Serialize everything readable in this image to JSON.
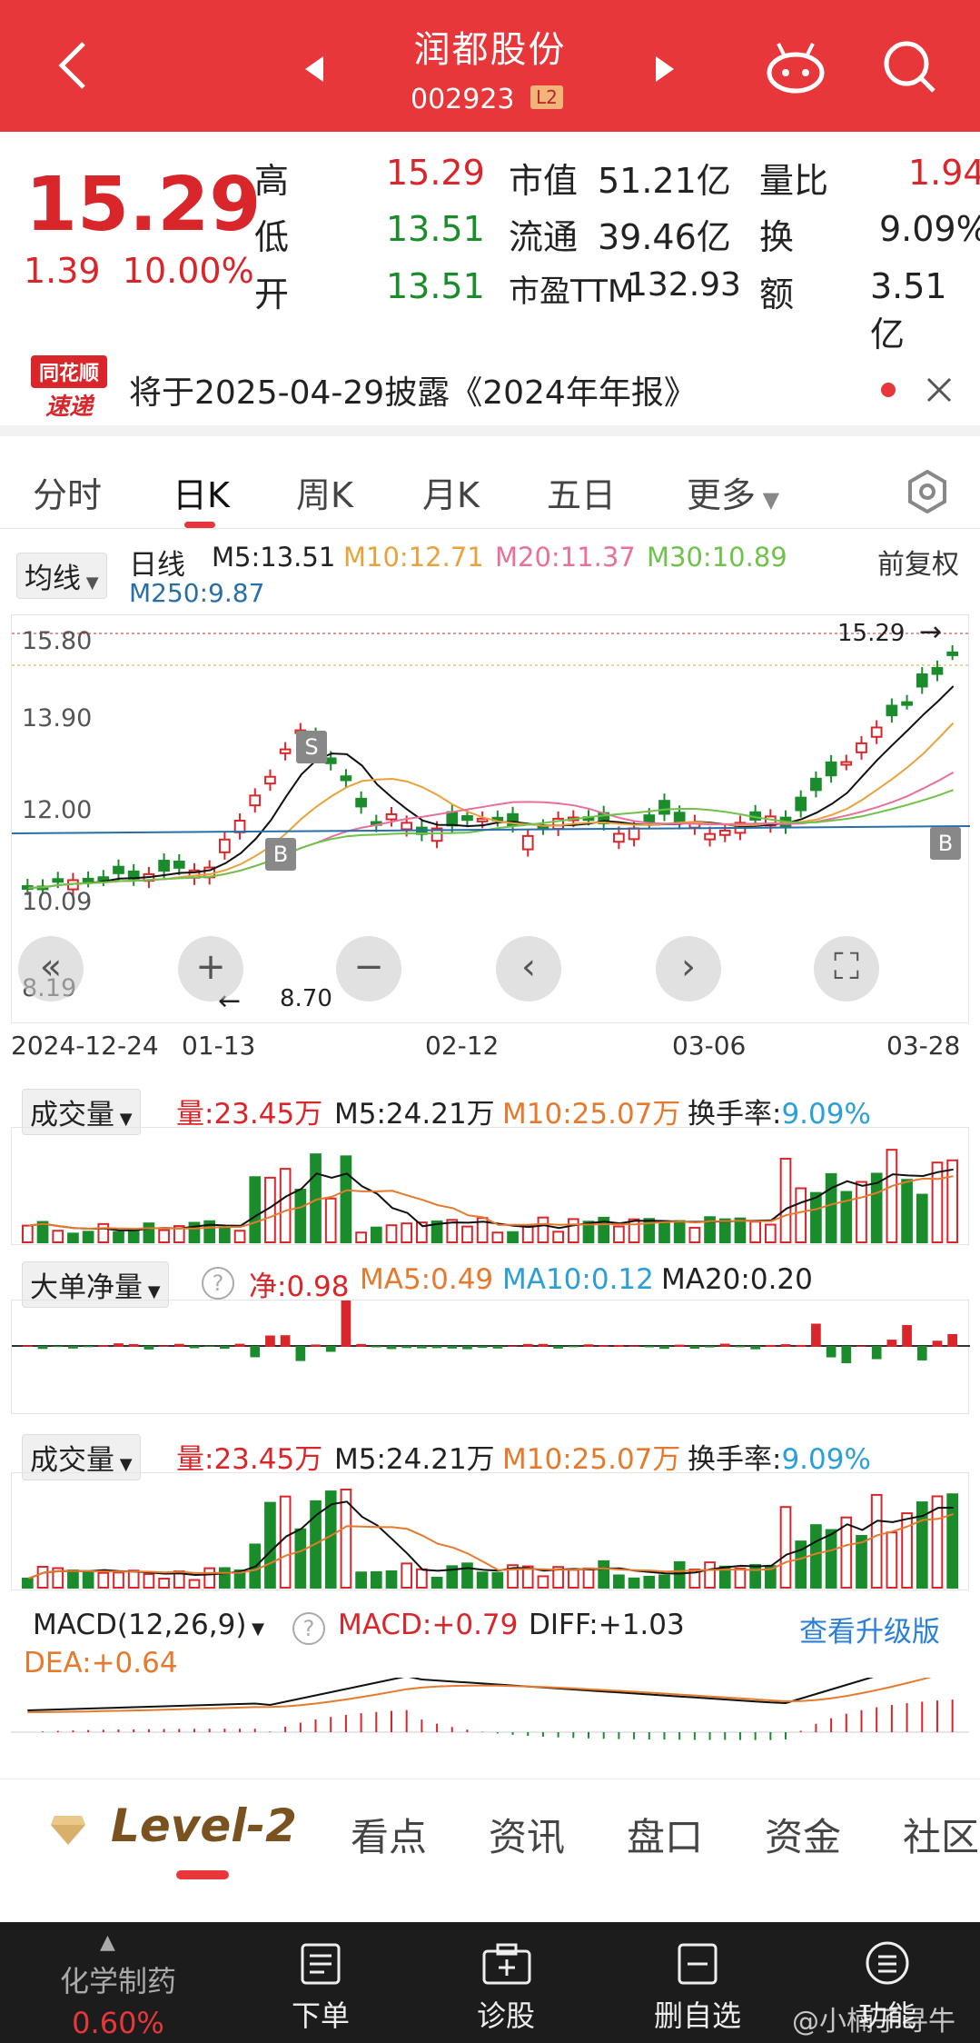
{
  "header": {
    "title": "润都股份",
    "code": "002923",
    "level_badge": "L2"
  },
  "quote": {
    "price": "15.29",
    "change": "1.39",
    "change_pct": "10.00%",
    "high_label": "高",
    "high": "15.29",
    "low_label": "低",
    "low": "13.51",
    "open_label": "开",
    "open": "13.51",
    "mktcap_label": "市值",
    "mktcap": "51.21亿",
    "float_label": "流通",
    "float": "39.46亿",
    "pe_label": "市盈TTM",
    "pe": "132.93",
    "volratio_label": "量比",
    "volratio": "1.94",
    "turnover_label": "换",
    "turnover": "9.09%",
    "amount_label": "额",
    "amount": "3.51亿"
  },
  "news": {
    "brand_line1": "同花顺",
    "brand_line2": "速递",
    "text": "将于2025-04-29披露《2024年年报》"
  },
  "tabs": [
    "分时",
    "日K",
    "周K",
    "月K",
    "五日",
    "更多"
  ],
  "active_tab": "日K",
  "ma_legend": {
    "selector": "均线",
    "period": "日线",
    "m5": "M5:13.51",
    "m10": "M10:12.71",
    "m20": "M20:11.37",
    "m30": "M30:10.89",
    "m250": "M250:9.87",
    "adjust": "前复权"
  },
  "kline": {
    "price_ticks": [
      "15.80",
      "13.90",
      "12.00",
      "10.09",
      "8.19"
    ],
    "last_label": "15.29",
    "low_label": "8.70",
    "date_ticks": [
      "2024-12-24",
      "01-13",
      "02-12",
      "03-06",
      "03-28"
    ],
    "markers": [
      "S",
      "B",
      "B"
    ]
  },
  "volume": {
    "label": "成交量",
    "vol": "量:23.45万",
    "m5": "M5:24.21万",
    "m10": "M10:25.07万",
    "turnover_label": "换手率:",
    "turnover": "9.09%"
  },
  "bigorder": {
    "label": "大单净量",
    "net": "净:0.98",
    "ma5": "MA5:0.49",
    "ma10": "MA10:0.12",
    "ma20": "MA20:0.20"
  },
  "volume2": {
    "label": "成交量",
    "vol": "量:23.45万",
    "m5": "M5:24.21万",
    "m10": "M10:25.07万",
    "turnover_label": "换手率:",
    "turnover": "9.09%"
  },
  "macd": {
    "label": "MACD(12,26,9)",
    "macd": "MACD:+0.79",
    "diff": "DIFF:+1.03",
    "dea": "DEA:+0.64",
    "upgrade": "查看升级版"
  },
  "bottom_tabs": [
    "Level-2",
    "看点",
    "资讯",
    "盘口",
    "资金",
    "社区"
  ],
  "footer": {
    "sector": "化学制药",
    "sector_pct": "0.60%",
    "items": [
      "下单",
      "诊股",
      "删自选",
      "功能"
    ],
    "watermark": "@小楠子寻牛"
  },
  "colors": {
    "accent": "#e8373a",
    "up": "#d8262b",
    "down": "#1a8c2b",
    "m5": "#111111",
    "m10": "#e9a23b",
    "m20": "#e8709a",
    "m30": "#6fc24a",
    "m250": "#2a6ea8"
  }
}
